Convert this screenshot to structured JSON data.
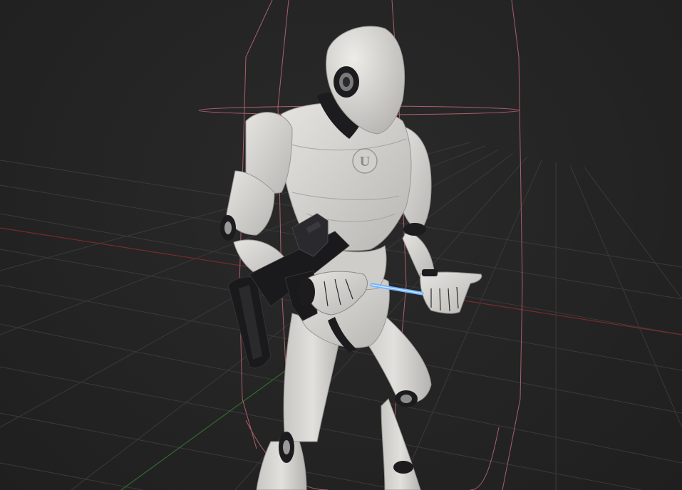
{
  "viewport": {
    "description_label": "",
    "background_color": "#252525",
    "grid_color": "#3a3a3a",
    "axis_x_color": "#7a2a2a",
    "axis_y_color": "#2f6a2f",
    "capsule_color": "#c06a78"
  },
  "character": {
    "body_color": "#d8d6d2",
    "joint_color": "#1c1c1e",
    "chest_logo": "U"
  },
  "weapon": {
    "color": "#1a1a1c"
  },
  "laser": {
    "color": "#6fb2ff"
  }
}
